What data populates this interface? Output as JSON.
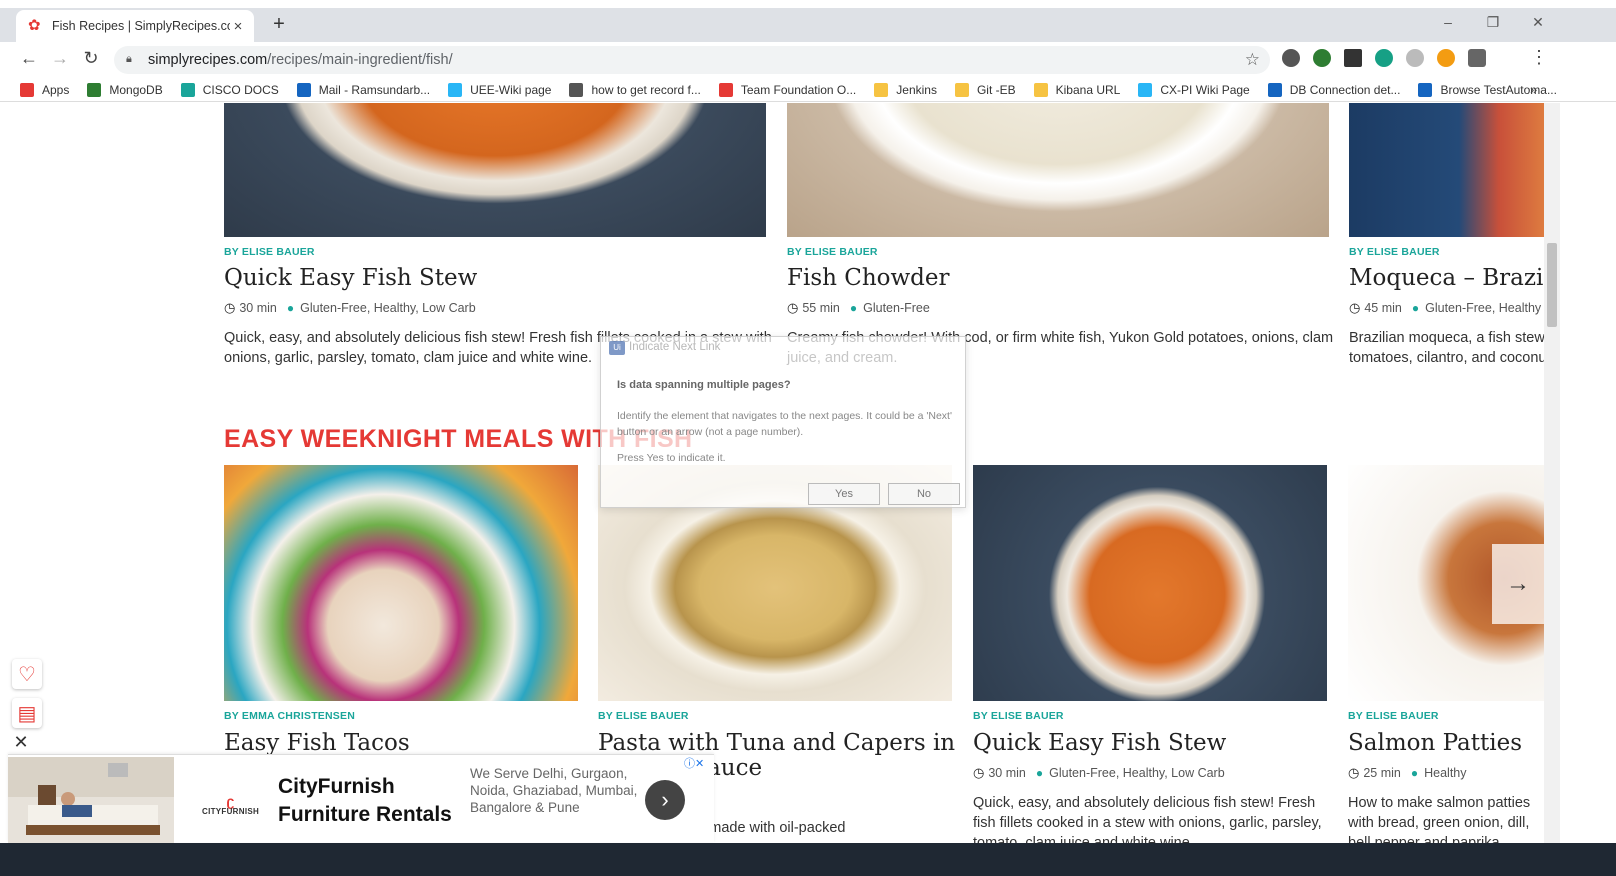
{
  "browser": {
    "tab_title": "Fish Recipes | SimplyRecipes.com",
    "tab_close": "×",
    "new_tab": "+",
    "url_domain": "simplyrecipes.com",
    "url_path": "/recipes/main-ingredient/fish/",
    "window_controls": {
      "minimize": "–",
      "restore": "❐",
      "close": "✕"
    },
    "nav": {
      "back": "←",
      "forward": "→",
      "reload": "↻"
    },
    "star": "☆",
    "menu": "⋮",
    "bookmarks": [
      {
        "label": "Apps",
        "icon": "apps-grid-icon",
        "color": "#e53935"
      },
      {
        "label": "MongoDB",
        "icon": "mongodb-icon",
        "color": "#2e7d32"
      },
      {
        "label": "CISCO DOCS",
        "icon": "cisco-icon",
        "color": "#1aa59a"
      },
      {
        "label": "Mail - Ramsundarb...",
        "icon": "outlook-icon",
        "color": "#1565c0"
      },
      {
        "label": "UEE-Wiki page",
        "icon": "wiki-icon",
        "color": "#29b6f6"
      },
      {
        "label": "how to get record f...",
        "icon": "horseshoe-icon",
        "color": "#555555"
      },
      {
        "label": "Team Foundation O...",
        "icon": "tfs-icon",
        "color": "#e53935"
      },
      {
        "label": "Jenkins",
        "icon": "folder-icon",
        "color": "#f6c342"
      },
      {
        "label": "Git -EB",
        "icon": "folder-icon",
        "color": "#f6c342"
      },
      {
        "label": "Kibana URL",
        "icon": "folder-icon",
        "color": "#f6c342"
      },
      {
        "label": "CX-PI Wiki Page",
        "icon": "wiki-icon",
        "color": "#29b6f6"
      },
      {
        "label": "DB Connection det...",
        "icon": "shield-icon",
        "color": "#1565c0"
      },
      {
        "label": "Browse TestAutoma...",
        "icon": "shield-icon",
        "color": "#1565c0"
      }
    ],
    "bookmarks_more": "»"
  },
  "top_row": [
    {
      "byline": "BY ELISE BAUER",
      "title": "Quick Easy Fish Stew",
      "time": "30 min",
      "tags": "Gluten-Free, Healthy, Low Carb",
      "desc": "Quick, easy, and absolutely delicious fish stew! Fresh fish fillets cooked in a stew with onions, garlic, parsley, tomato, clam juice and white wine."
    },
    {
      "byline": "BY ELISE BAUER",
      "title": "Fish Chowder",
      "time": "55 min",
      "tags": "Gluten-Free",
      "desc": "Creamy fish chowder! With cod, or firm white fish, Yukon Gold potatoes, onions, clam juice, and cream."
    },
    {
      "byline": "BY ELISE BAUER",
      "title": "Moqueca – Brazilian Fish Stew",
      "time": "45 min",
      "tags": "Gluten-Free, Healthy",
      "desc": "Brazilian moqueca, a fish stew with peppers, tomatoes, cilantro, and coconut milk."
    }
  ],
  "section_heading": "EASY WEEKNIGHT MEALS WITH FISH",
  "bottom_row": [
    {
      "byline": "BY EMMA CHRISTENSEN",
      "title": "Easy Fish Tacos"
    },
    {
      "byline": "BY ELISE BAUER",
      "title": "Pasta with Tuna and Capers in",
      "title2": "Tomato Sauce",
      "desc": "Pasta in a sauce made with oil-packed"
    },
    {
      "byline": "BY ELISE BAUER",
      "title": "Quick Easy Fish Stew",
      "time": "30 min",
      "tags": "Gluten-Free, Healthy, Low Carb",
      "desc": "Quick, easy, and absolutely delicious fish stew! Fresh fish fillets cooked in a stew with onions, garlic, parsley, tomato, clam juice and white wine."
    },
    {
      "byline": "BY ELISE BAUER",
      "title": "Salmon Patties",
      "time": "25 min",
      "tags": "Healthy",
      "desc": "How to make salmon patties with bread, green onion, dill, bell pepper and paprika."
    }
  ],
  "dialog": {
    "title": "Indicate Next Link",
    "question": "Is data spanning multiple pages?",
    "body": "Identify the element that navigates to the next pages. It could be a 'Next' button or an arrow (not a page number).",
    "press": "Press Yes to indicate it.",
    "yes": "Yes",
    "no": "No"
  },
  "carousel_next": "→",
  "ad": {
    "logo_text": "CITYFURNISH",
    "brand_line1": "CityFurnish",
    "brand_line2": "Furniture Rentals",
    "copy": "We Serve Delhi, Gurgaon, Noida, Ghaziabad, Mumbai, Bangalore & Pune",
    "go": "›",
    "choices": "ⓘ✕",
    "dismiss": "✕"
  },
  "colors": {
    "accent_teal": "#1aa59a",
    "heading_red": "#e53935"
  }
}
